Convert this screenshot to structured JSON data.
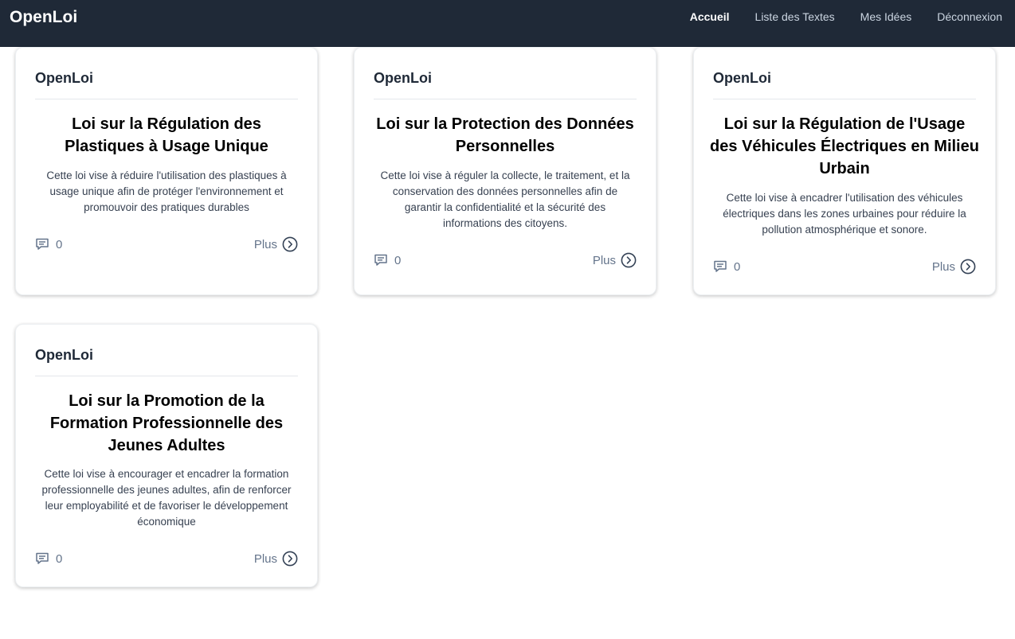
{
  "navbar": {
    "brand": "OpenLoi",
    "links": [
      {
        "label": "Accueil",
        "active": true
      },
      {
        "label": "Liste des Textes",
        "active": false
      },
      {
        "label": "Mes Idées",
        "active": false
      },
      {
        "label": "Déconnexion",
        "active": false
      }
    ]
  },
  "cards": [
    {
      "brand": "OpenLoi",
      "title": "Loi sur la Régulation des Plastiques à Usage Unique",
      "description": "Cette loi vise à réduire l'utilisation des plastiques à usage unique afin de protéger l'environnement et promouvoir des pratiques durables",
      "comment_count": "0",
      "more_label": "Plus",
      "comment_icon": "comment-icon",
      "more_icon": "chevron-right-circle-icon"
    },
    {
      "brand": "OpenLoi",
      "title": "Loi sur la Protection des Données Personnelles",
      "description": "Cette loi vise à réguler la collecte, le traitement, et la conservation des données personnelles afin de garantir la confidentialité et la sécurité des informations des citoyens.",
      "comment_count": "0",
      "more_label": "Plus",
      "comment_icon": "comment-icon",
      "more_icon": "chevron-right-circle-icon"
    },
    {
      "brand": "OpenLoi",
      "title": "Loi sur la Régulation de l'Usage des Véhicules Électriques en Milieu Urbain",
      "description": "Cette loi vise à encadrer l'utilisation des véhicules électriques dans les zones urbaines pour réduire la pollution atmosphérique et sonore.",
      "comment_count": "0",
      "more_label": "Plus",
      "comment_icon": "comment-icon",
      "more_icon": "chevron-right-circle-icon"
    },
    {
      "brand": "OpenLoi",
      "title": "Loi sur la Promotion de la Formation Professionnelle des Jeunes Adultes",
      "description": "Cette loi vise à encourager et encadrer la formation professionnelle des jeunes adultes, afin de renforcer leur employabilité et de favoriser le développement économique",
      "comment_count": "0",
      "more_label": "Plus",
      "comment_icon": "comment-icon",
      "more_icon": "chevron-right-circle-icon"
    }
  ],
  "colors": {
    "navbar_bg": "#1f2937",
    "muted_text": "#64748b"
  }
}
